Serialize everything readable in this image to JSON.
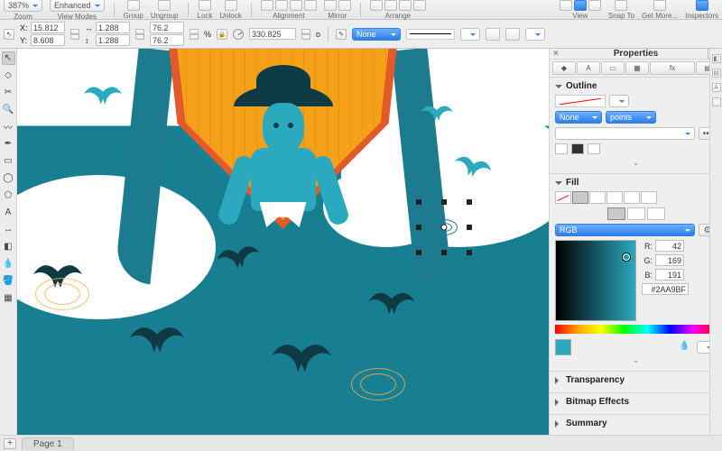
{
  "toolbar": {
    "zoom": "387%",
    "zoom_label": "Zoom",
    "view_modes": "Enhanced",
    "view_modes_label": "View Modes",
    "group_label": "Group",
    "ungroup_label": "Ungroup",
    "lock_label": "Lock",
    "unlock_label": "Unlock",
    "alignment_label": "Alignment",
    "mirror_label": "Mirror",
    "arrange_label": "Arrange",
    "view_label": "View",
    "snapto_label": "Snap To",
    "getmore_label": "Get More...",
    "inspectors_label": "Inspectors"
  },
  "coords": {
    "x_label": "X:",
    "y_label": "Y:",
    "x": "15.812",
    "y": "8.608",
    "w": "1.288",
    "h": "1.288",
    "pw": "76.2",
    "ph": "76.2",
    "percent": "%",
    "rotation": "330.825",
    "deg": "o",
    "stroke_style": "None"
  },
  "props": {
    "title": "Properties",
    "outline": {
      "title": "Outline",
      "style": "None",
      "units": "points",
      "more": "•••"
    },
    "fill": {
      "title": "Fill",
      "mode": "RGB",
      "r_label": "R:",
      "g_label": "G:",
      "b_label": "B:",
      "r": "42",
      "g": "169",
      "b": "191",
      "hex": "#2AA9BF"
    },
    "transparency": "Transparency",
    "bitmap": "Bitmap Effects",
    "summary": "Summary"
  },
  "pagebar": {
    "page1": "Page 1"
  }
}
